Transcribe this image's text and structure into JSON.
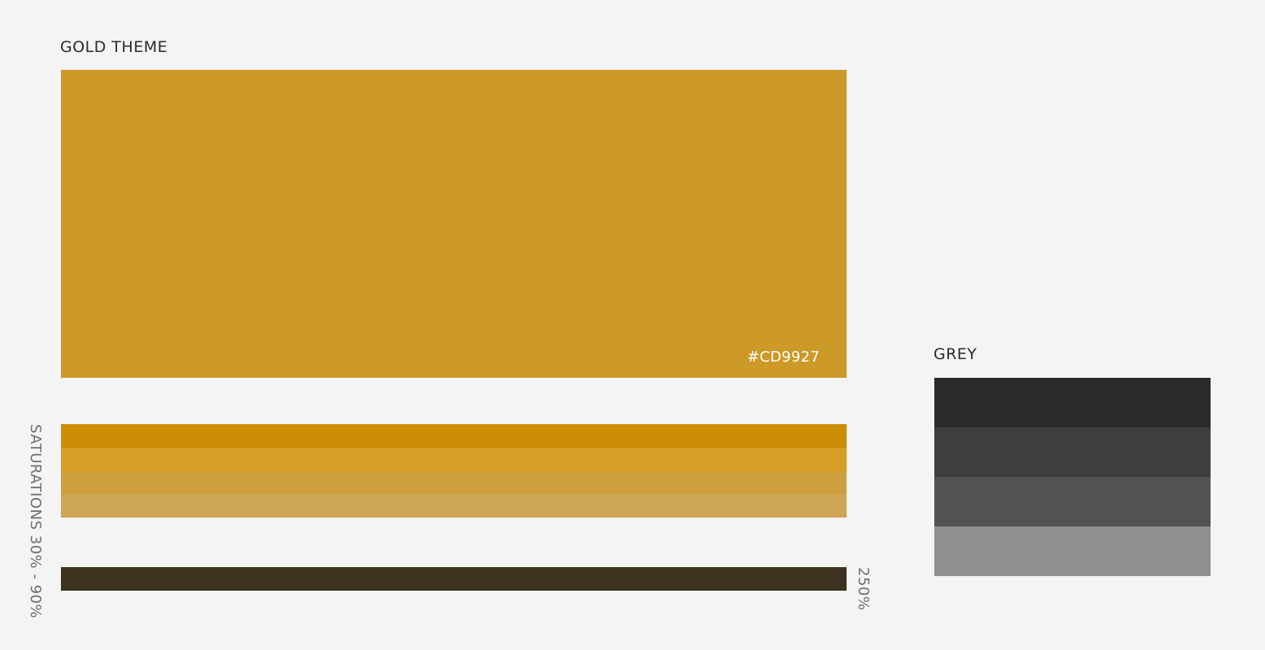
{
  "gold": {
    "title": "GOLD THEME",
    "hex_label": "#CD9927",
    "main_color": "#CD9927",
    "saturation_caption_line1": "SATURATIONS",
    "saturation_caption_line2": "30% - 90%",
    "saturations": [
      {
        "color": "#CC8C04"
      },
      {
        "color": "#D59E27"
      },
      {
        "color": "#CE9F3F"
      },
      {
        "color": "#CEA553"
      }
    ],
    "dark_color": "#3C321F",
    "dark_caption": "250%"
  },
  "grey": {
    "title": "GREY",
    "swatches": [
      {
        "color": "#2A2A2A"
      },
      {
        "color": "#3E3E3E"
      },
      {
        "color": "#525252"
      },
      {
        "color": "#8F8F8F"
      }
    ]
  }
}
